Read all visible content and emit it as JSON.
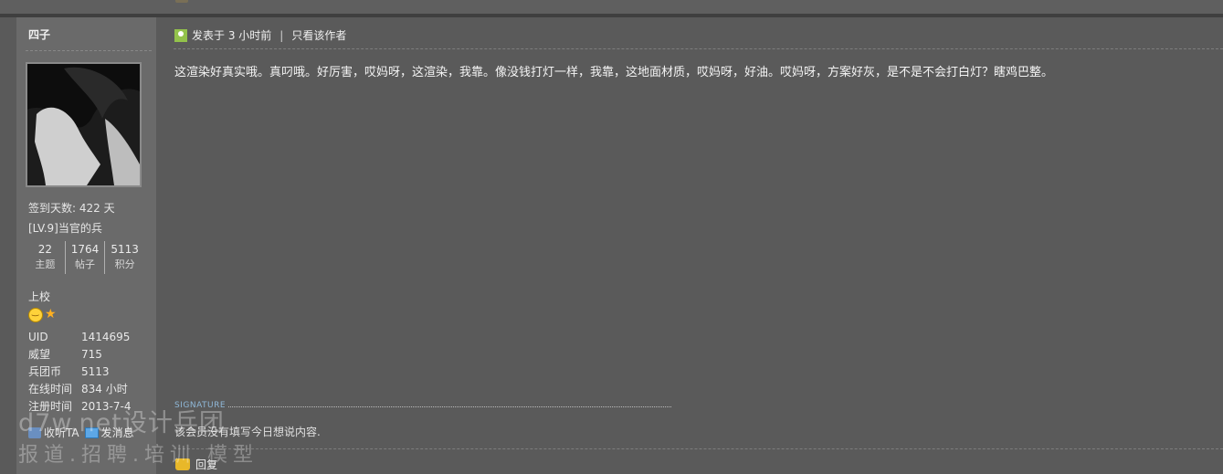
{
  "post": {
    "header_posted": "发表于 3 小时前",
    "header_divider": "|",
    "header_author_only": "只看该作者",
    "body": "这渲染好真实哦。真叼哦。好厉害，哎妈呀，这渲染，我靠。像没钱打灯一样，我靠，这地面材质，哎妈呀，好油。哎妈呀，方案好灰，是不是不会打白灯？瞎鸡巴整。",
    "signature_label": "SIGNATURE",
    "signature_text": "该会员没有填写今日想说内容.",
    "reply_label": "回复"
  },
  "user": {
    "name": "四子",
    "sign_days": "签到天数: 422 天",
    "level": "[LV.9]当官的兵",
    "stats": [
      {
        "num": "22",
        "label": "主题"
      },
      {
        "num": "1764",
        "label": "帖子"
      },
      {
        "num": "5113",
        "label": "积分"
      }
    ],
    "rank": "上校",
    "info": [
      {
        "k": "UID",
        "v": "1414695"
      },
      {
        "k": "威望",
        "v": "715"
      },
      {
        "k": "兵团币",
        "v": "5113"
      },
      {
        "k": "在线时间",
        "v": "834 小时"
      },
      {
        "k": "注册时间",
        "v": "2013-7-4"
      }
    ],
    "action_follow": "收听TA",
    "action_message": "发消息"
  },
  "watermark": {
    "line1": "d7w.net设计兵团",
    "line2": "报道.招聘.培训.模型"
  },
  "colors": {
    "background": "#5a5a5a",
    "sidebar": "#6a6a6a",
    "accent": "#8fb8d8"
  }
}
